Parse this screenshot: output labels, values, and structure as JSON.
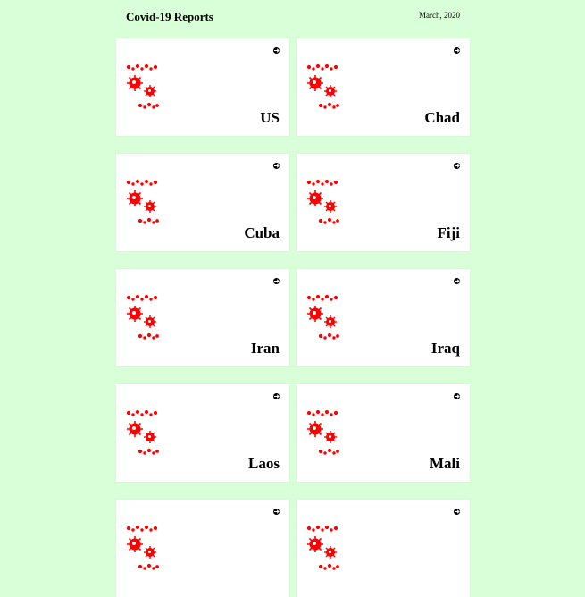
{
  "header": {
    "title": "Covid-19 Reports",
    "date": "March, 2020"
  },
  "cards": [
    {
      "country": "US",
      "icon": "arrow-right-circle-icon"
    },
    {
      "country": "Chad",
      "icon": "arrow-right-circle-icon"
    },
    {
      "country": "Cuba",
      "icon": "arrow-right-circle-icon"
    },
    {
      "country": "Fiji",
      "icon": "arrow-right-circle-icon"
    },
    {
      "country": "Iran",
      "icon": "arrow-right-circle-icon"
    },
    {
      "country": "Iraq",
      "icon": "arrow-right-circle-icon"
    },
    {
      "country": "Laos",
      "icon": "arrow-right-circle-icon"
    },
    {
      "country": "Mali",
      "icon": "arrow-right-circle-icon"
    },
    {
      "country": "",
      "icon": "arrow-right-circle-icon"
    },
    {
      "country": "",
      "icon": "arrow-right-circle-icon"
    }
  ],
  "colors": {
    "background": "#d9ffd9",
    "card": "#ffffff",
    "virus": "#ff0000"
  }
}
